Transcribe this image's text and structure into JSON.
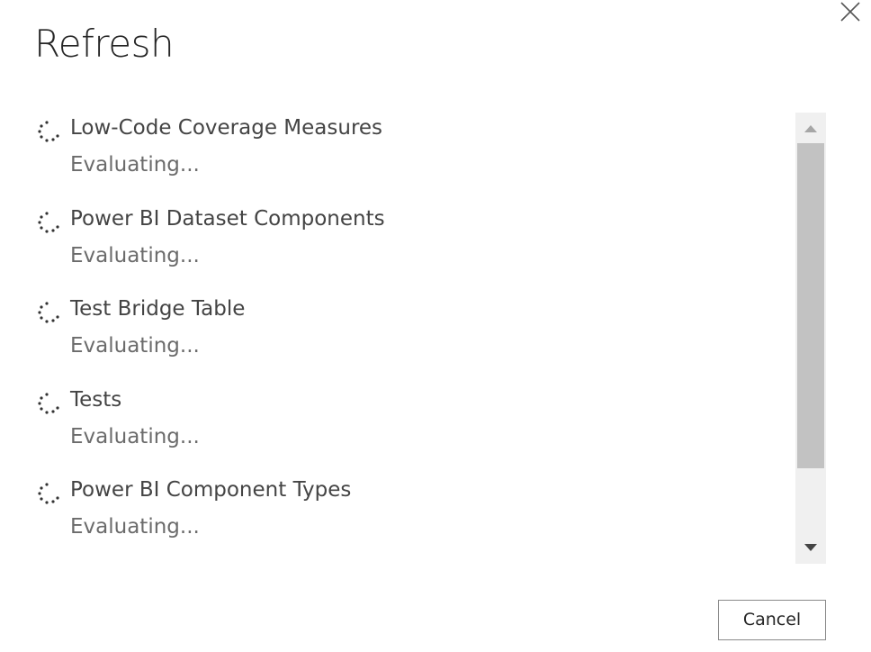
{
  "dialog": {
    "title": "Refresh",
    "close_icon": "close-icon",
    "cancel_label": "Cancel"
  },
  "queries": [
    {
      "name": "Low-Code Coverage Measures",
      "status": "Evaluating..."
    },
    {
      "name": "Power BI Dataset Components",
      "status": "Evaluating..."
    },
    {
      "name": "Test Bridge Table",
      "status": "Evaluating..."
    },
    {
      "name": "Tests",
      "status": "Evaluating..."
    },
    {
      "name": "Power BI Component Types",
      "status": "Evaluating..."
    }
  ],
  "icons": {
    "spinner": "loading-spinner-icon",
    "scroll_up": "scroll-up-arrow-icon",
    "scroll_down": "scroll-down-arrow-icon"
  },
  "colors": {
    "title": "#262626",
    "text": "#444444",
    "status": "#6b6b6b",
    "scroll_track": "#f0f0f0",
    "scroll_thumb": "#c2c2c2",
    "button_border": "#8a8a8a"
  }
}
